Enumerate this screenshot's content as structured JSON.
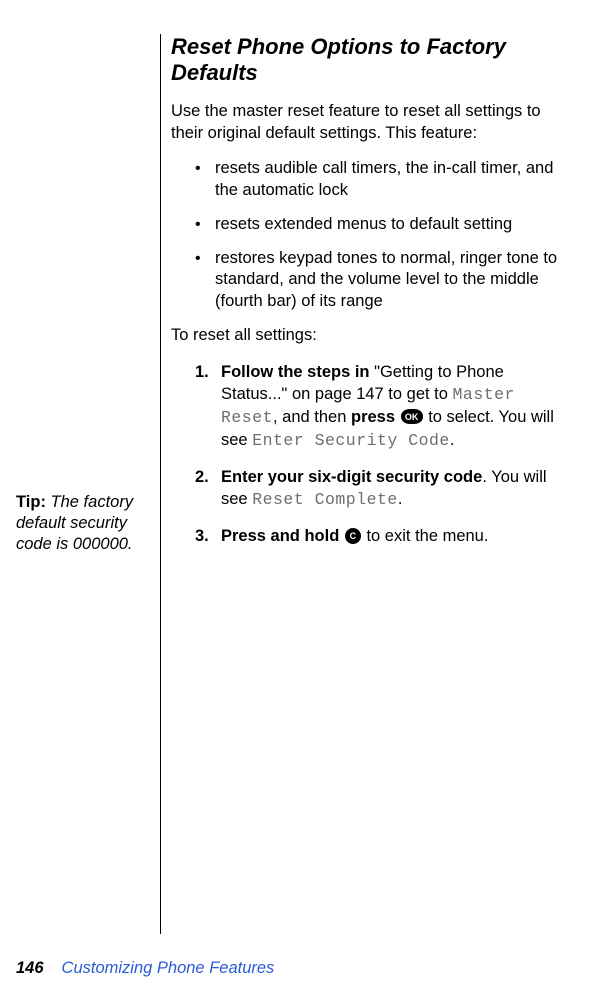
{
  "heading": "Reset Phone Options to Factory Defaults",
  "intro": "Use the master reset feature to reset all settings to their original default settings. This feature:",
  "bullets": [
    "resets audible call timers, the in-call timer, and the automatic lock",
    "resets extended menus to default setting",
    "restores keypad tones to normal, ringer tone to standard, and the volume level to the middle (fourth bar) of its range"
  ],
  "lead": "To reset all settings:",
  "steps": {
    "s1": {
      "num": "1.",
      "bold_a": "Follow the steps in",
      "text_a": " \"Getting to Phone Status...\" on page 147 to get to ",
      "lcd_a": "Master Reset",
      "text_b": ", and then ",
      "bold_b": "press",
      "key_label_a": "OK",
      "text_c": " to select. You will see ",
      "lcd_b": "Enter Security Code",
      "text_d": "."
    },
    "s2": {
      "num": "2.",
      "bold_a": "Enter your six-digit security code",
      "text_a": ". You will see ",
      "lcd_a": "Reset Complete",
      "text_b": "."
    },
    "s3": {
      "num": "3.",
      "bold_a": "Press and hold",
      "key_label_a": "C",
      "text_a": " to exit the menu."
    }
  },
  "tip": {
    "label": "Tip:",
    "body": " The factory default security code is 000000."
  },
  "footer": {
    "page": "146",
    "chapter": "Customizing Phone Features"
  }
}
